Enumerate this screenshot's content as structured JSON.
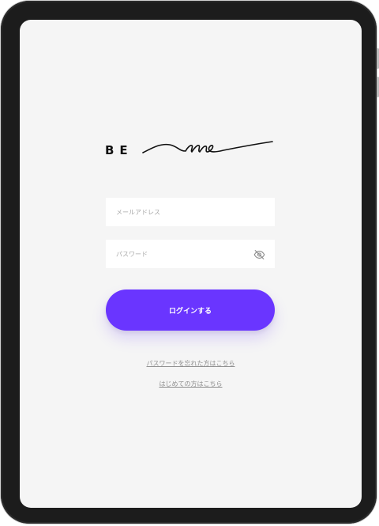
{
  "logo": {
    "text": "BE",
    "script_word": "me"
  },
  "login_form": {
    "email_placeholder": "メールアドレス",
    "email_value": "",
    "password_placeholder": "パスワード",
    "password_value": "",
    "password_visibility_icon": "eye-off-icon",
    "submit_label": "ログインする"
  },
  "links": {
    "forgot_password": "パスワードを忘れた方はこちら",
    "first_time": "はじめての方はこちら"
  },
  "colors": {
    "accent": "#6a35ff",
    "background": "#f5f5f5",
    "device_frame": "#1c1c1c",
    "input_background": "#ffffff",
    "link_text": "#8f8f8f"
  }
}
